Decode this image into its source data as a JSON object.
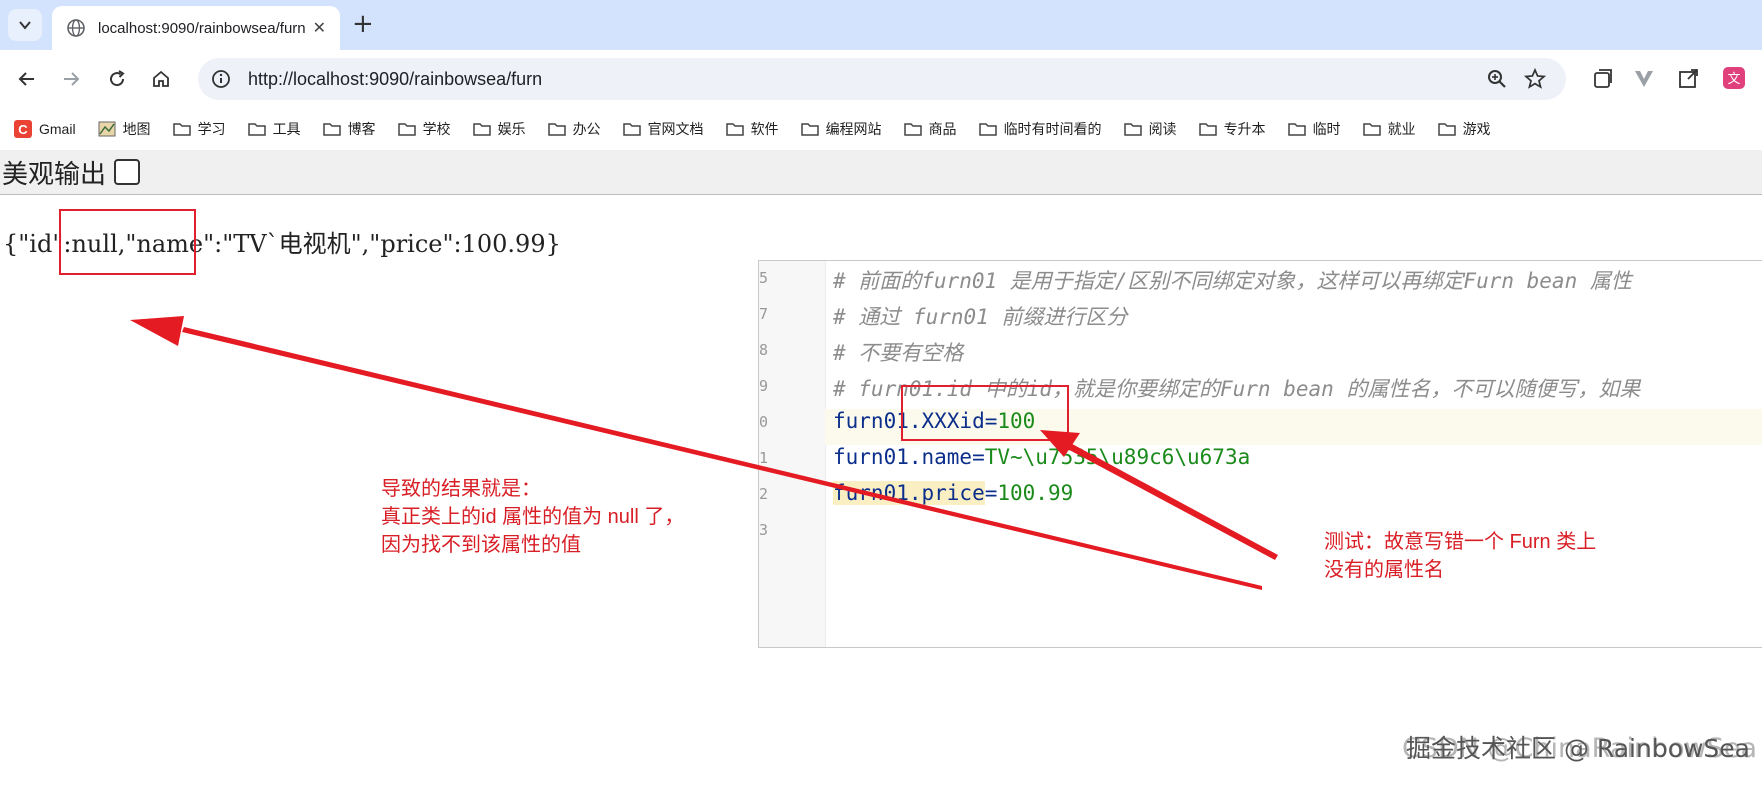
{
  "browser": {
    "tab_title": "localhost:9090/rainbowsea/furn",
    "url": "http://localhost:9090/rainbowsea/furn",
    "bookmarks": [
      "Gmail",
      "地图",
      "学习",
      "工具",
      "博客",
      "学校",
      "娱乐",
      "办公",
      "官网文档",
      "软件",
      "编程网站",
      "商品",
      "临时有时间看的",
      "阅读",
      "专升本",
      "临时",
      "就业",
      "游戏"
    ]
  },
  "page": {
    "pretty_label": "美观输出",
    "json_output": "{\"id\":null,\"name\":\"TV`电视机\",\"price\":100.99}"
  },
  "ide": {
    "line_numbers": [
      "5",
      "7",
      "8",
      "9",
      "0",
      "1",
      "2",
      "3"
    ],
    "comment1": "# 前面的furn01 是用于指定/区别不同绑定对象，这样可以再绑定Furn bean 属性",
    "comment2": "# 通过 furn01 前缀进行区分",
    "comment3": "# 不要有空格",
    "comment4": "# furn01.id 中的id，就是你要绑定的Furn bean 的属性名，不可以随便写，如果",
    "line_id_key": "furn01.XXXid",
    "line_id_val": "100",
    "line_name_key": "furn01.name",
    "line_name_val": "TV~\\u7535\\u89c6\\u673a",
    "line_price_key": "furn01.price",
    "line_price_val": "100.99"
  },
  "annotations": {
    "left_line1": "导致的结果就是：",
    "left_line2": "真正类上的id 属性的值为 null 了，",
    "left_line3": "因为找不到该属性的值",
    "right_line1": "测试：故意写错一个 Furn 类上",
    "right_line2": "没有的属性名"
  },
  "watermark": {
    "back": "CSDN @ChinaRainbowSea",
    "front": "掘金技术社区 @ RainbowSea"
  },
  "colors": {
    "accent_red": "#e0212d",
    "tabstrip": "#d3e3fd"
  }
}
